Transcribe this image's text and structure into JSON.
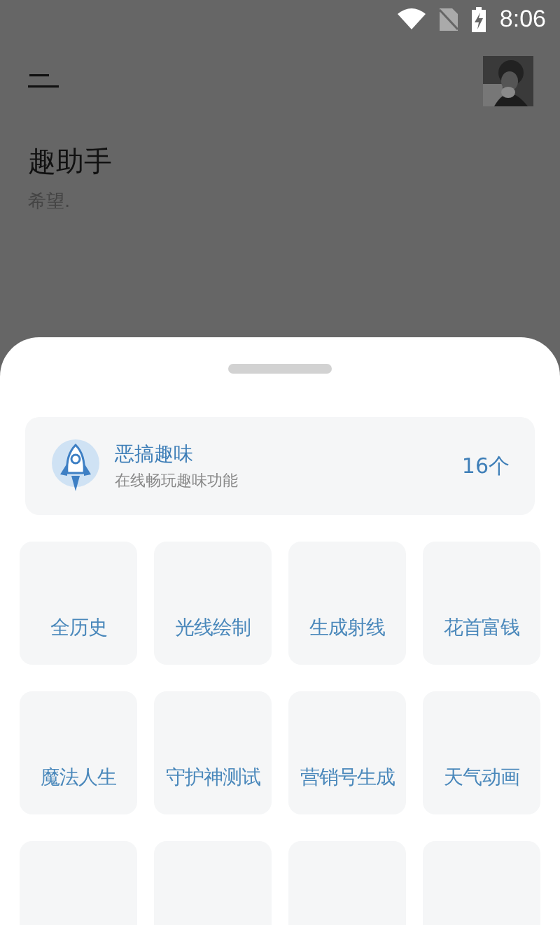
{
  "status_bar": {
    "time": "8:06"
  },
  "header": {
    "title": "趣助手",
    "subtitle": "希望."
  },
  "category": {
    "title": "恶搞趣味",
    "subtitle": "在线畅玩趣味功能",
    "count": "16个"
  },
  "tools": [
    {
      "kind": "tile",
      "label": "全历史"
    },
    {
      "kind": "tile",
      "label": "光线绘制"
    },
    {
      "kind": "tile",
      "label": "生成射线"
    },
    {
      "kind": "tile",
      "label": "花首富钱"
    },
    {
      "kind": "tile",
      "label": "魔法人生"
    },
    {
      "kind": "tile",
      "label": "守护神测试"
    },
    {
      "kind": "tile",
      "label": "营销号生成"
    },
    {
      "kind": "tile",
      "label": "天气动画"
    },
    {
      "kind": "cut_tile"
    },
    {
      "kind": "cut_tile"
    },
    {
      "kind": "cut_tile"
    },
    {
      "kind": "cut_tile"
    }
  ]
}
